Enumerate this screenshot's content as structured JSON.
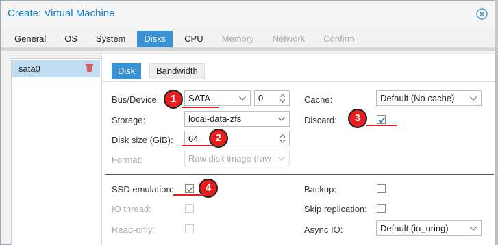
{
  "window": {
    "title": "Create: Virtual Machine"
  },
  "tabs": [
    {
      "label": "General",
      "state": "normal"
    },
    {
      "label": "OS",
      "state": "normal"
    },
    {
      "label": "System",
      "state": "normal"
    },
    {
      "label": "Disks",
      "state": "active"
    },
    {
      "label": "CPU",
      "state": "normal"
    },
    {
      "label": "Memory",
      "state": "disabled"
    },
    {
      "label": "Network",
      "state": "disabled"
    },
    {
      "label": "Confirm",
      "state": "disabled"
    }
  ],
  "disk_list": {
    "items": [
      {
        "label": "sata0",
        "selected": true
      }
    ]
  },
  "subtabs": {
    "disk": "Disk",
    "bandwidth": "Bandwidth"
  },
  "form": {
    "bus_device": {
      "label": "Bus/Device:",
      "bus": "SATA",
      "device": "0"
    },
    "storage": {
      "label": "Storage:",
      "value": "local-data-zfs"
    },
    "disk_size": {
      "label": "Disk size (GiB):",
      "value": "64"
    },
    "format": {
      "label": "Format:",
      "value": "Raw disk image (raw"
    },
    "cache": {
      "label": "Cache:",
      "value": "Default (No cache)"
    },
    "discard": {
      "label": "Discard:",
      "checked": true
    },
    "ssd_emulation": {
      "label": "SSD emulation:",
      "checked": true
    },
    "io_thread": {
      "label": "IO thread:",
      "checked": false
    },
    "read_only": {
      "label": "Read-only:",
      "checked": false
    },
    "backup": {
      "label": "Backup:",
      "checked": false
    },
    "skip_replication": {
      "label": "Skip replication:",
      "checked": false
    },
    "async_io": {
      "label": "Async IO:",
      "value": "Default (io_uring)"
    }
  },
  "annotations": {
    "one": "1",
    "two": "2",
    "three": "3",
    "four": "4"
  },
  "colors": {
    "accent": "#3892d4",
    "title": "#157fcc",
    "annotation": "#e61e1e",
    "selection": "#c1ddf1"
  },
  "icons": {
    "close": "close-circle-icon",
    "delete": "trash-icon",
    "dropdown": "chevron-down-icon",
    "spinner": "spinner-arrows-icon",
    "check": "check-icon"
  }
}
